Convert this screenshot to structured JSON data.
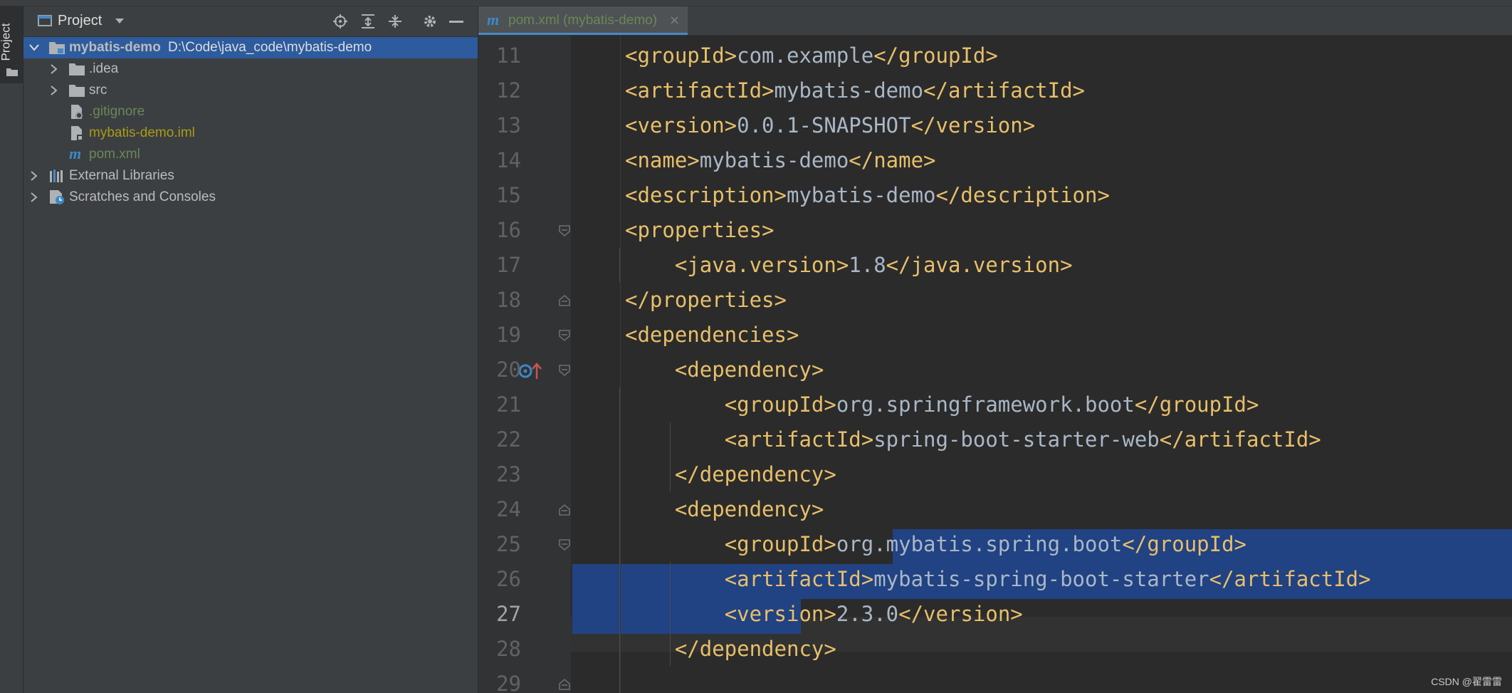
{
  "side_tool": {
    "project_label": "Project"
  },
  "project_panel": {
    "title": "Project",
    "tree": [
      {
        "label": "mybatis-demo",
        "path": "D:\\Code\\java_code\\mybatis-demo",
        "color": "#ffffff"
      },
      {
        "label": ".idea",
        "color": "#bbbbbb"
      },
      {
        "label": "src",
        "color": "#bbbbbb"
      },
      {
        "label": ".gitignore",
        "color": "#6a8759"
      },
      {
        "label": "mybatis-demo.iml",
        "color": "#a99b16"
      },
      {
        "label": "pom.xml",
        "color": "#6a8759"
      },
      {
        "label": "External Libraries",
        "color": "#bbbbbb"
      },
      {
        "label": "Scratches and Consoles",
        "color": "#bbbbbb"
      }
    ]
  },
  "editor": {
    "tab_label": "pom.xml (mybatis-demo)",
    "tab_icon": "m",
    "tab_close": "×",
    "lines": [
      {
        "num": "11",
        "parts": [
          [
            "t",
            "<groupId>"
          ],
          [
            "v",
            "com.example"
          ],
          [
            "t",
            "</groupId>"
          ]
        ]
      },
      {
        "num": "12",
        "parts": [
          [
            "t",
            "<artifactId>"
          ],
          [
            "v",
            "mybatis-demo"
          ],
          [
            "t",
            "</artifactId>"
          ]
        ]
      },
      {
        "num": "13",
        "parts": [
          [
            "t",
            "<version>"
          ],
          [
            "v",
            "0.0.1-SNAPSHOT"
          ],
          [
            "t",
            "</version>"
          ]
        ]
      },
      {
        "num": "14",
        "parts": [
          [
            "t",
            "<name>"
          ],
          [
            "v",
            "mybatis-demo"
          ],
          [
            "t",
            "</name>"
          ]
        ]
      },
      {
        "num": "15",
        "parts": [
          [
            "t",
            "<description>"
          ],
          [
            "v",
            "mybatis-demo"
          ],
          [
            "t",
            "</description>"
          ]
        ]
      },
      {
        "num": "16",
        "parts": [
          [
            "t",
            "<properties>"
          ]
        ]
      },
      {
        "num": "17",
        "parts": [
          [
            "v",
            "    "
          ],
          [
            "t",
            "<java.version>"
          ],
          [
            "v",
            "1.8"
          ],
          [
            "t",
            "</java.version>"
          ]
        ]
      },
      {
        "num": "18",
        "parts": [
          [
            "t",
            "</properties>"
          ]
        ]
      },
      {
        "num": "19",
        "parts": [
          [
            "t",
            "<dependencies>"
          ]
        ]
      },
      {
        "num": "20",
        "parts": [
          [
            "v",
            "    "
          ],
          [
            "t",
            "<dependency>"
          ]
        ]
      },
      {
        "num": "21",
        "parts": [
          [
            "v",
            "        "
          ],
          [
            "t",
            "<groupId>"
          ],
          [
            "v",
            "org.springframework.boot"
          ],
          [
            "t",
            "</groupId>"
          ]
        ]
      },
      {
        "num": "22",
        "parts": [
          [
            "v",
            "        "
          ],
          [
            "t",
            "<artifactId>"
          ],
          [
            "v",
            "spring-boot-starter-web"
          ],
          [
            "t",
            "</artifactId>"
          ]
        ]
      },
      {
        "num": "23",
        "parts": [
          [
            "v",
            "    "
          ],
          [
            "t",
            "</dependency>"
          ]
        ]
      },
      {
        "num": "24",
        "parts": [
          [
            "v",
            "    "
          ],
          [
            "t",
            "<dependency>"
          ]
        ]
      },
      {
        "num": "25",
        "parts": [
          [
            "v",
            "        "
          ],
          [
            "t",
            "<groupId>"
          ],
          [
            "v",
            "org.mybatis.spring.boot"
          ],
          [
            "t",
            "</groupId>"
          ]
        ]
      },
      {
        "num": "26",
        "parts": [
          [
            "v",
            "        "
          ],
          [
            "t",
            "<artifactId>"
          ],
          [
            "v",
            "mybatis-spring-boot-starter"
          ],
          [
            "t",
            "</artifactId>"
          ]
        ]
      },
      {
        "num": "27",
        "parts": [
          [
            "v",
            "        "
          ],
          [
            "t",
            "<version>"
          ],
          [
            "v",
            "2.3.0"
          ],
          [
            "t",
            "</version>"
          ]
        ]
      },
      {
        "num": "28",
        "parts": [
          [
            "v",
            "    "
          ],
          [
            "t",
            "</dependency>"
          ]
        ]
      },
      {
        "num": "29",
        "parts": []
      }
    ]
  },
  "colors": {
    "tag": "#e8bf6a",
    "text": "#a9b7c6",
    "selection": "#214283",
    "selected_row": "#2d5b9e"
  },
  "watermark": "CSDN @翟雷雷"
}
